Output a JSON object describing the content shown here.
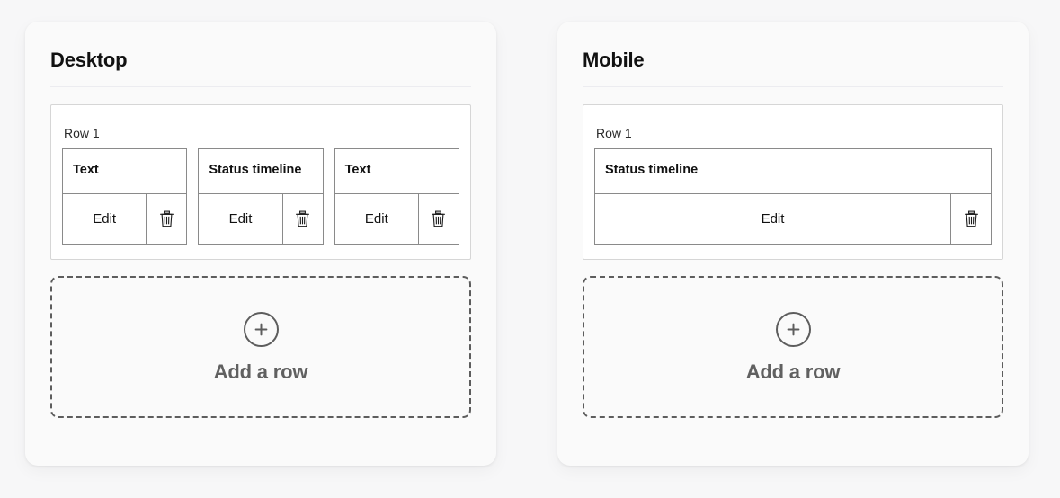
{
  "background_color": "#f7f7f8",
  "panel_color": "#fafafa",
  "border_color": "#8a8a8a",
  "dashed_color": "#5d5d5d",
  "panels": [
    {
      "key": "desktop",
      "title": "Desktop",
      "row": {
        "label": "Row 1",
        "widgets": [
          {
            "title": "Text",
            "edit_label": "Edit",
            "delete_icon": "trash-icon"
          },
          {
            "title": "Status timeline",
            "edit_label": "Edit",
            "delete_icon": "trash-icon"
          },
          {
            "title": "Text",
            "edit_label": "Edit",
            "delete_icon": "trash-icon"
          }
        ]
      },
      "add_row": {
        "label": "Add a row",
        "icon": "plus-circle-icon"
      }
    },
    {
      "key": "mobile",
      "title": "Mobile",
      "row": {
        "label": "Row 1",
        "widgets": [
          {
            "title": "Status timeline",
            "edit_label": "Edit",
            "delete_icon": "trash-icon"
          }
        ]
      },
      "add_row": {
        "label": "Add a row",
        "icon": "plus-circle-icon"
      }
    }
  ]
}
